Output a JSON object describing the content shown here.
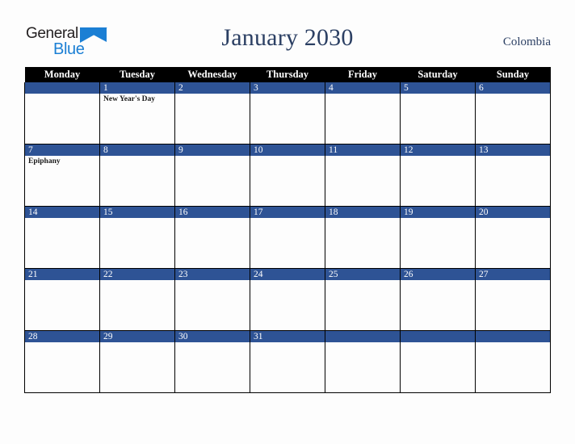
{
  "header": {
    "logo": {
      "word1": "General",
      "word2": "Blue",
      "triangle_color": "#1b7fd4"
    },
    "title": "January 2030",
    "region": "Colombia"
  },
  "calendar": {
    "weekday_headers": [
      "Monday",
      "Tuesday",
      "Wednesday",
      "Thursday",
      "Friday",
      "Saturday",
      "Sunday"
    ],
    "colors": {
      "header_bg": "#000000",
      "header_text": "#ffffff",
      "datebar_bg": "#2e5395",
      "datebar_text": "#ffffff",
      "cell_bg": "#fdfdfd",
      "grid_line": "#000000",
      "title_text": "#2b3f63"
    },
    "weeks": [
      {
        "days": [
          {
            "date": "",
            "events": []
          },
          {
            "date": "1",
            "events": [
              "New Year's Day"
            ]
          },
          {
            "date": "2",
            "events": []
          },
          {
            "date": "3",
            "events": []
          },
          {
            "date": "4",
            "events": []
          },
          {
            "date": "5",
            "events": []
          },
          {
            "date": "6",
            "events": []
          }
        ]
      },
      {
        "days": [
          {
            "date": "7",
            "events": [
              "Epiphany"
            ]
          },
          {
            "date": "8",
            "events": []
          },
          {
            "date": "9",
            "events": []
          },
          {
            "date": "10",
            "events": []
          },
          {
            "date": "11",
            "events": []
          },
          {
            "date": "12",
            "events": []
          },
          {
            "date": "13",
            "events": []
          }
        ]
      },
      {
        "days": [
          {
            "date": "14",
            "events": []
          },
          {
            "date": "15",
            "events": []
          },
          {
            "date": "16",
            "events": []
          },
          {
            "date": "17",
            "events": []
          },
          {
            "date": "18",
            "events": []
          },
          {
            "date": "19",
            "events": []
          },
          {
            "date": "20",
            "events": []
          }
        ]
      },
      {
        "days": [
          {
            "date": "21",
            "events": []
          },
          {
            "date": "22",
            "events": []
          },
          {
            "date": "23",
            "events": []
          },
          {
            "date": "24",
            "events": []
          },
          {
            "date": "25",
            "events": []
          },
          {
            "date": "26",
            "events": []
          },
          {
            "date": "27",
            "events": []
          }
        ]
      },
      {
        "days": [
          {
            "date": "28",
            "events": []
          },
          {
            "date": "29",
            "events": []
          },
          {
            "date": "30",
            "events": []
          },
          {
            "date": "31",
            "events": []
          },
          {
            "date": "",
            "events": []
          },
          {
            "date": "",
            "events": []
          },
          {
            "date": "",
            "events": []
          }
        ]
      }
    ]
  }
}
